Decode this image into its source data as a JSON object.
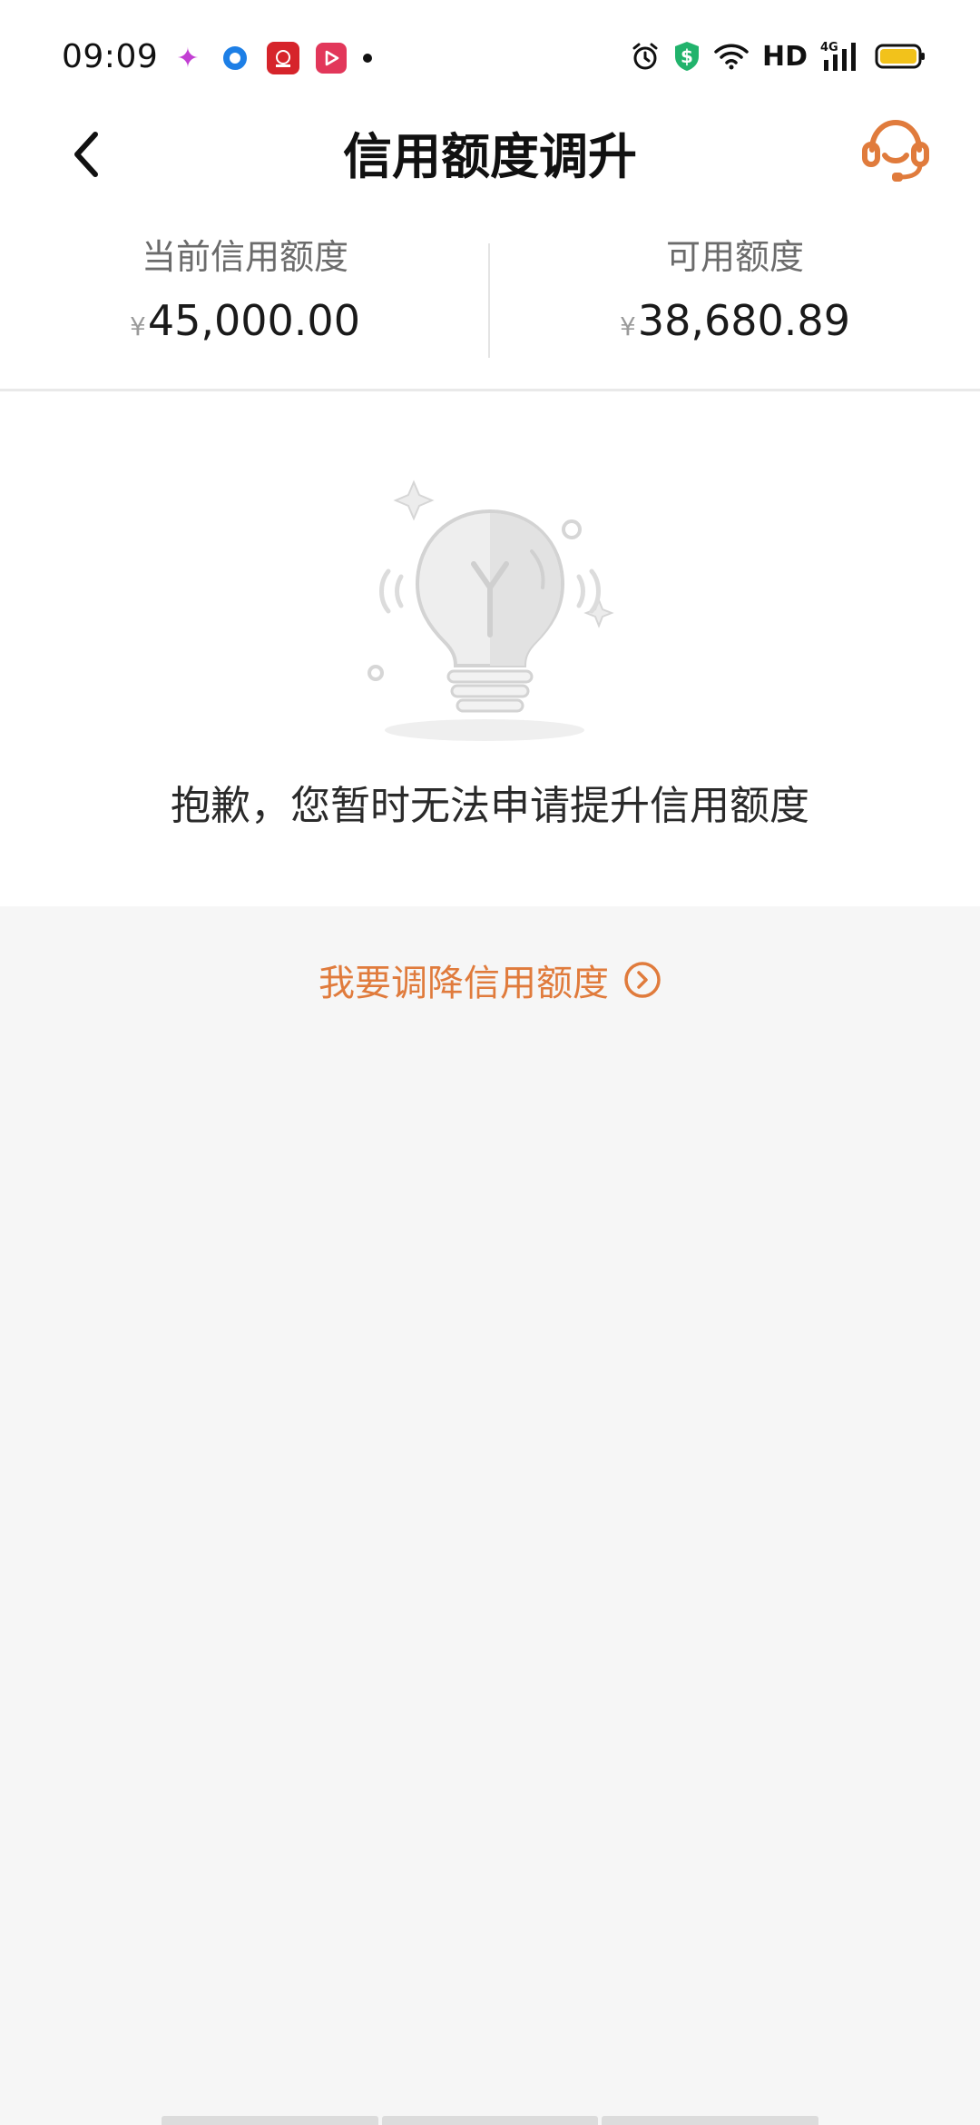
{
  "status_bar": {
    "time": "09:09",
    "network_label": "HD",
    "signal_label": "4G",
    "app_icons": [
      "star-app-icon",
      "circle-app-icon",
      "red-app-icon",
      "play-app-icon"
    ],
    "right_icons": [
      "alarm-icon",
      "shield-dollar-icon",
      "wifi-icon",
      "signal-icon",
      "battery-icon"
    ]
  },
  "header": {
    "title": "信用额度调升",
    "back_icon": "chevron-left-icon",
    "service_icon": "customer-service-headset-icon"
  },
  "summary": {
    "current_label": "当前信用额度",
    "current_currency": "¥",
    "current_value": "45,000.00",
    "available_label": "可用额度",
    "available_currency": "¥",
    "available_value": "38,680.89"
  },
  "message": {
    "illustration": "lightbulb-icon",
    "text": "抱歉，您暂时无法申请提升信用额度"
  },
  "decrease": {
    "label": "我要调降信用额度",
    "icon": "chevron-circle-right-icon"
  },
  "colors": {
    "accent": "#e07b3c",
    "background": "#f6f6f6",
    "card": "#ffffff"
  }
}
